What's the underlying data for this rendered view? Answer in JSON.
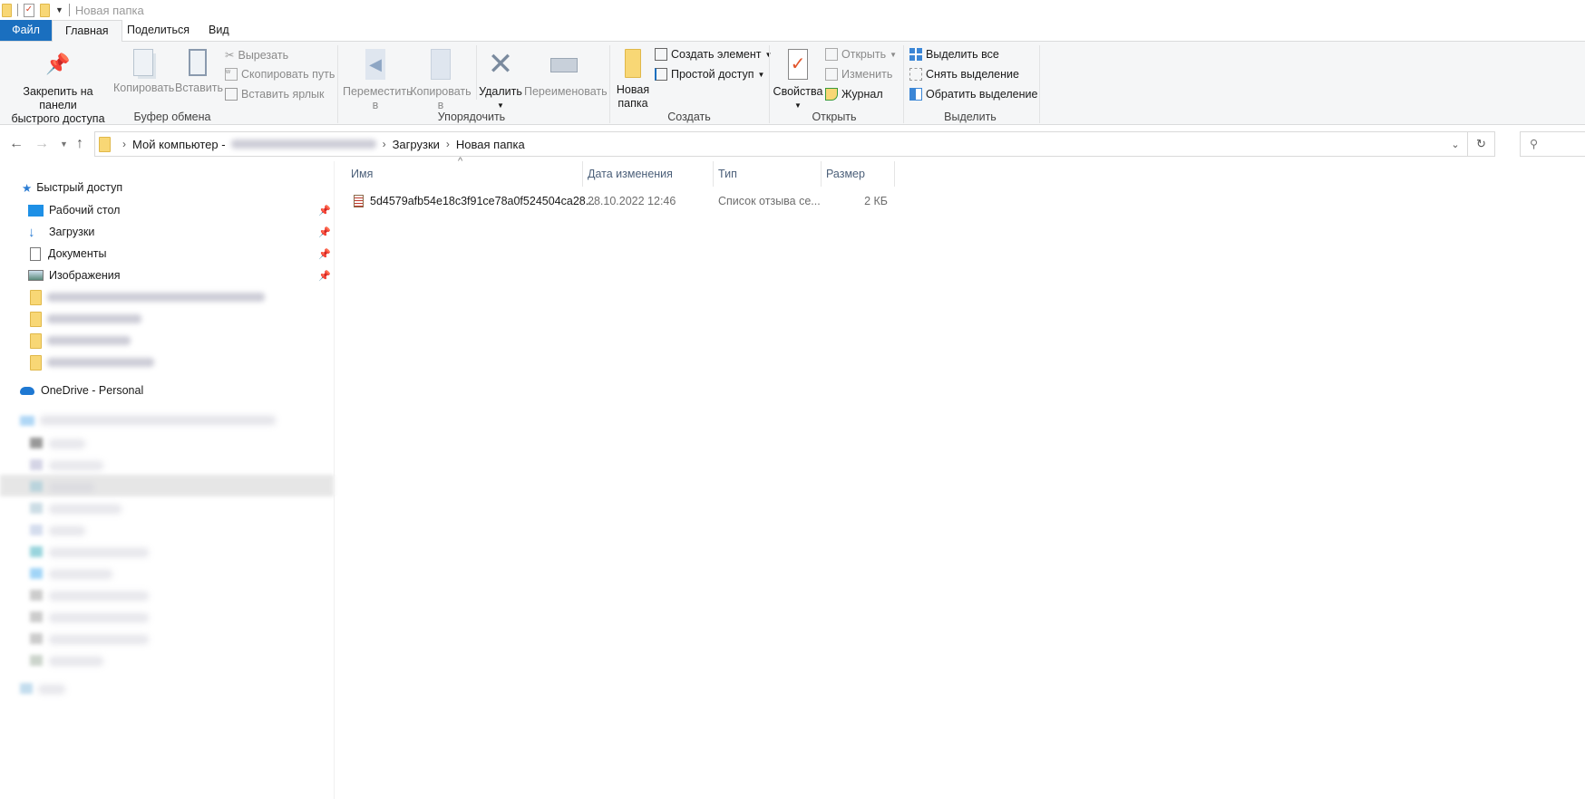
{
  "window": {
    "title": "Новая папка"
  },
  "tabs": [
    {
      "label": "Файл",
      "active": false,
      "accent": "#1a6fbf"
    },
    {
      "label": "Главная",
      "active": true
    },
    {
      "label": "Поделиться"
    },
    {
      "label": "Вид"
    }
  ],
  "ribbon": {
    "clipboard": {
      "label": "Буфер обмена",
      "pin_line1": "Закрепить на панели",
      "pin_line2": "быстрого доступа",
      "copy": "Копировать",
      "paste": "Вставить",
      "cut": "Вырезать",
      "copy_path": "Скопировать путь",
      "paste_shortcut": "Вставить ярлык"
    },
    "organize": {
      "label": "Упорядочить",
      "move_line1": "Переместить",
      "move_line2": "в",
      "copy_line1": "Копировать",
      "copy_line2": "в",
      "delete": "Удалить",
      "rename": "Переименовать"
    },
    "create": {
      "label": "Создать",
      "new_folder_line1": "Новая",
      "new_folder_line2": "папка",
      "new_item": "Создать элемент",
      "easy_access": "Простой доступ"
    },
    "open": {
      "label": "Открыть",
      "properties": "Свойства",
      "open": "Открыть",
      "edit": "Изменить",
      "history": "Журнал"
    },
    "select": {
      "label": "Выделить",
      "select_all": "Выделить все",
      "select_none": "Снять выделение",
      "invert": "Обратить выделение"
    }
  },
  "address": {
    "crumbs": [
      "Мой компьютер -",
      "Загрузки",
      "Новая папка"
    ]
  },
  "sidebar": {
    "quick_access": "Быстрый доступ",
    "pinned": [
      {
        "label": "Рабочий стол",
        "icon": "desktop-icon"
      },
      {
        "label": "Загрузки",
        "icon": "downloads-icon"
      },
      {
        "label": "Документы",
        "icon": "documents-icon"
      },
      {
        "label": "Изображения",
        "icon": "pictures-icon"
      }
    ],
    "onedrive": "OneDrive - Personal"
  },
  "columns": {
    "name": "Имя",
    "date": "Дата изменения",
    "type": "Тип",
    "size": "Размер"
  },
  "files": [
    {
      "name": "5d4579afb54e18c3f91ce78a0f524504ca28...",
      "date": "28.10.2022 12:46",
      "type": "Список отзыва се...",
      "size": "2 КБ"
    }
  ]
}
